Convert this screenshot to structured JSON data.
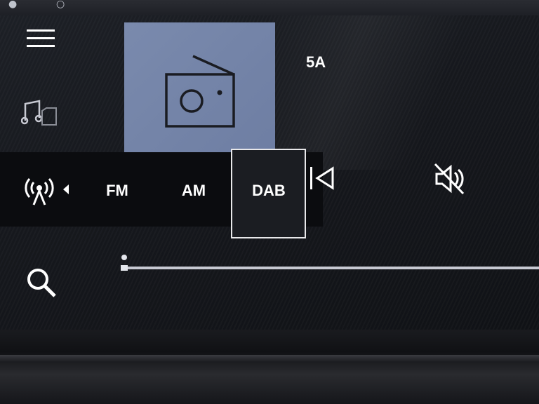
{
  "station": {
    "name": "5A"
  },
  "bands": {
    "options": [
      "FM",
      "AM",
      "DAB"
    ],
    "selected": "DAB"
  },
  "icons": {
    "menu": "menu-icon",
    "music_source": "music-source-icon",
    "artwork": "radio-icon",
    "antenna": "antenna-icon",
    "band_dropdown": "caret-left-icon",
    "previous": "skip-previous-icon",
    "mute": "volume-mute-icon",
    "search": "search-icon"
  },
  "colors": {
    "artwork_background": "#7a8aad",
    "text": "#ffffff",
    "selection_border": "#e8e8ea"
  }
}
